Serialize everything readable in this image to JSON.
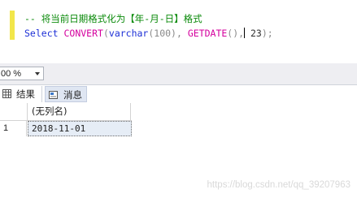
{
  "editor": {
    "comment": "-- 将当前日期格式化为【年-月-日】格式",
    "code": {
      "select_kw": "Select",
      "convert_fn": "CONVERT",
      "open_paren": "(",
      "varchar_kw": "varchar",
      "length_args": "(100), ",
      "getdate_fn": "GETDATE",
      "getdate_parens": "(),",
      "style_arg": " 23",
      "close": ");"
    }
  },
  "zoom": {
    "value": "00 %"
  },
  "tabs": [
    {
      "label": "结果",
      "icon": "grid-icon"
    },
    {
      "label": "消息",
      "icon": "message-icon"
    }
  ],
  "grid": {
    "columns": [
      "(无列名)"
    ],
    "rows": [
      {
        "num": "1",
        "values": [
          "2018-11-01"
        ]
      }
    ]
  },
  "watermark": "https://blog.csdn.net/qq_39207963",
  "colors": {
    "comment": "#0a8a0a",
    "keyword": "#1c2fd6",
    "function": "#d4009e",
    "gutter_marker": "#f2e64a",
    "selected_cell": "#e6edf6"
  }
}
